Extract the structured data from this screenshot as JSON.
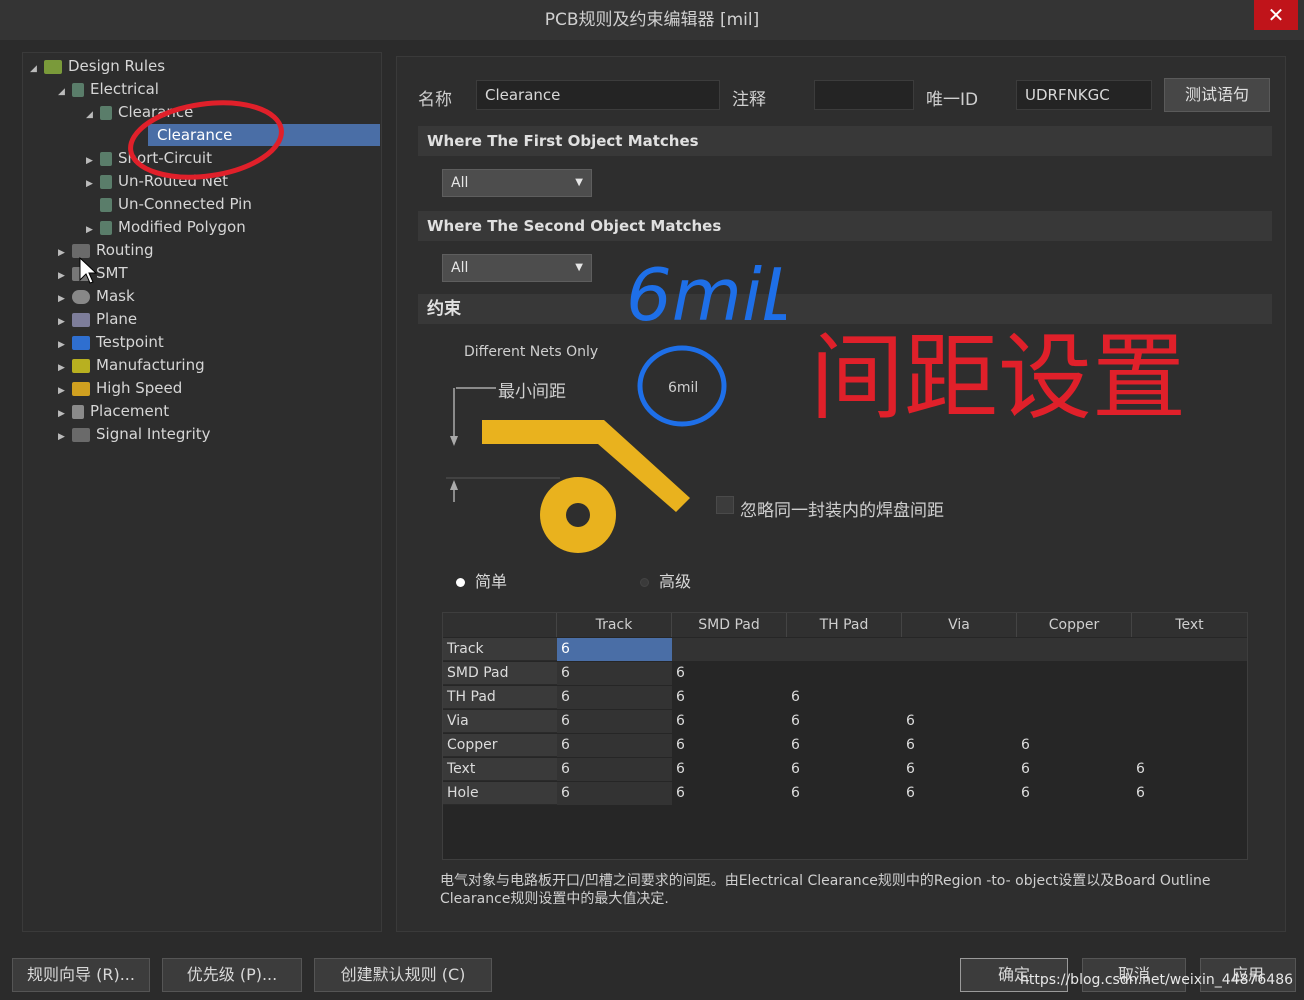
{
  "window": {
    "title": "PCB规则及约束编辑器 [mil]",
    "close_glyph": "✕"
  },
  "tree": {
    "root": "Design Rules",
    "electrical": "Electrical",
    "clearance_group": "Clearance",
    "clearance_rule": "Clearance",
    "short_circuit": "Short-Circuit",
    "un_routed_net": "Un-Routed Net",
    "un_connected_pin": "Un-Connected Pin",
    "modified_polygon": "Modified Polygon",
    "routing": "Routing",
    "smt": "SMT",
    "mask": "Mask",
    "plane": "Plane",
    "testpoint": "Testpoint",
    "manufacturing": "Manufacturing",
    "high_speed": "High Speed",
    "placement": "Placement",
    "signal_integrity": "Signal Integrity"
  },
  "header": {
    "name_label": "名称",
    "name_value": "Clearance",
    "comment_label": "注释",
    "comment_value": "",
    "id_label": "唯一ID",
    "id_value": "UDRFNKGC",
    "test_button": "测试语句"
  },
  "first_match": {
    "title": "Where The First Object Matches",
    "value": "All"
  },
  "second_match": {
    "title": "Where The Second Object Matches",
    "value": "All"
  },
  "constraint": {
    "title": "约束",
    "different_nets": "Different Nets Only",
    "min_spacing_label": "最小间距",
    "min_spacing_value": "6mil",
    "ignore_pads_label": "忽略同一封装内的焊盘间距",
    "mode_simple": "简单",
    "mode_advanced": "高级"
  },
  "annotations": {
    "blue_text": "6miL",
    "red_text": "间距设置"
  },
  "table": {
    "columns": [
      "Track",
      "SMD Pad",
      "TH Pad",
      "Via",
      "Copper",
      "Text"
    ],
    "rows": [
      {
        "label": "Track",
        "values": [
          "6"
        ]
      },
      {
        "label": "SMD Pad",
        "values": [
          "6",
          "6"
        ]
      },
      {
        "label": "TH Pad",
        "values": [
          "6",
          "6",
          "6"
        ]
      },
      {
        "label": "Via",
        "values": [
          "6",
          "6",
          "6",
          "6"
        ]
      },
      {
        "label": "Copper",
        "values": [
          "6",
          "6",
          "6",
          "6",
          "6"
        ]
      },
      {
        "label": "Text",
        "values": [
          "6",
          "6",
          "6",
          "6",
          "6",
          "6"
        ]
      },
      {
        "label": "Hole",
        "values": [
          "6",
          "6",
          "6",
          "6",
          "6",
          "6"
        ]
      }
    ]
  },
  "description": "电气对象与电路板开口/凹槽之间要求的间距。由Electrical Clearance规则中的Region -to- object设置以及Board Outline Clearance规则设置中的最大值决定.",
  "footer": {
    "wizard": "规则向导 (R)...",
    "priority": "优先级 (P)...",
    "create_default": "创建默认规则 (C)",
    "ok": "确定",
    "cancel": "取消",
    "apply": "应用",
    "watermark": "https://blog.csdn.net/weixin_44876486"
  },
  "colors": {
    "accent_selected": "#4a6ea6",
    "copper_yellow": "#e9b21e",
    "annotation_red": "#e0202a",
    "annotation_blue": "#1e6fe8"
  }
}
